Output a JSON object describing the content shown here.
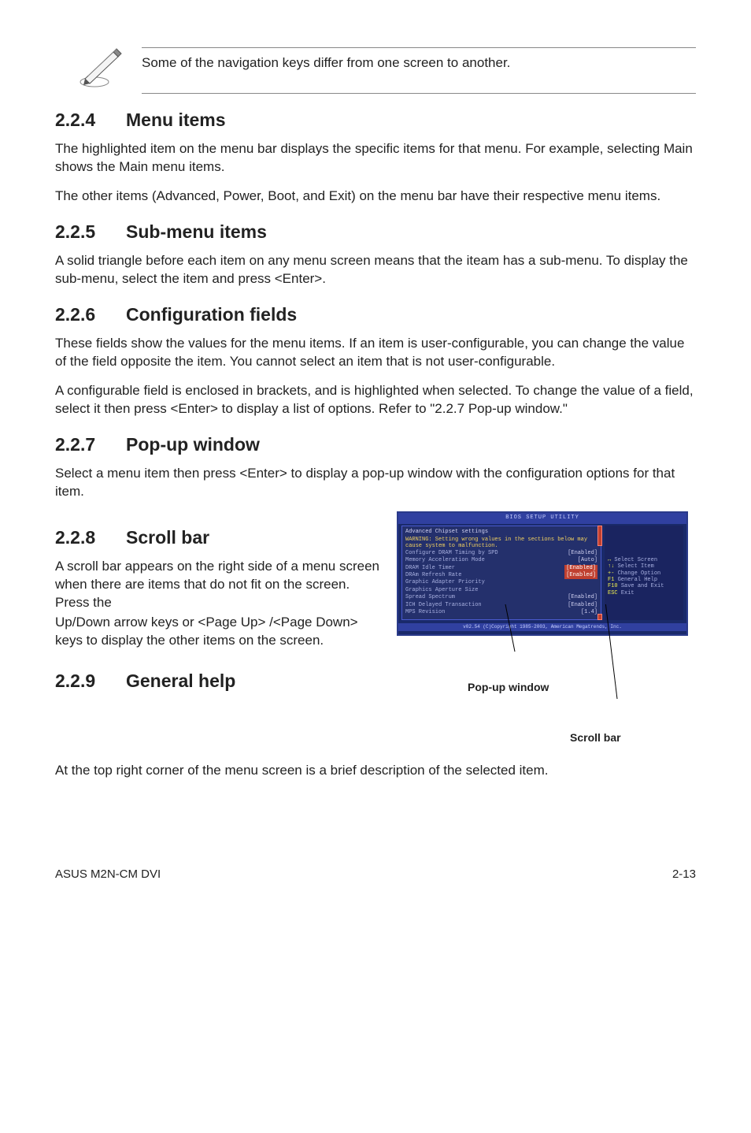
{
  "note": {
    "text": "Some of the navigation keys differ from one screen to another."
  },
  "s224": {
    "num": "2.2.4",
    "title": "Menu items",
    "p1": "The highlighted item on the menu bar  displays the specific items for that menu. For example, selecting Main shows the Main menu items.",
    "p2": "The other items (Advanced, Power, Boot, and Exit) on the menu bar have their respective menu items."
  },
  "s225": {
    "num": "2.2.5",
    "title": "Sub-menu items",
    "p1": "A solid triangle before each item on any menu screen means that the iteam has a sub-menu. To display the sub-menu, select the item and press <Enter>."
  },
  "s226": {
    "num": "2.2.6",
    "title": "Configuration fields",
    "p1": "These fields show the values for the menu items. If an item is user-configurable, you can change the value of the field opposite the item. You cannot select an item that is not user-configurable.",
    "p2": "A configurable field is enclosed in brackets, and is highlighted when selected. To change the value of a field, select it then press <Enter> to display a list of options. Refer to \"2.2.7 Pop-up window.\""
  },
  "s227": {
    "num": "2.2.7",
    "title": "Pop-up window",
    "p1": "Select a menu item then press <Enter> to display a pop-up window with the configuration options for that item."
  },
  "s228": {
    "num": "2.2.8",
    "title": "Scroll bar",
    "p1": "A scroll bar appears on the right side of a menu screen when there are items that do not fit on the screen. Press the",
    "p2": "Up/Down arrow keys or <Page Up> /<Page Down> keys to display the other items on the screen."
  },
  "s229": {
    "num": "2.2.9",
    "title": "General help",
    "p1": "At the top right corner of the menu screen is a brief description of the selected item."
  },
  "bios": {
    "titlebar": "BIOS SETUP UTILITY",
    "panel_header": "Advanced Chipset settings",
    "warning": "WARNING: Setting wrong values in the sections below may cause system to malfunction.",
    "rows": [
      {
        "label": "Configure DRAM Timing by SPD",
        "value": "[Enabled]",
        "sel": false
      },
      {
        "label": "Memory Acceleration Mode",
        "value": "[Auto]",
        "sel": false
      },
      {
        "label": "DRAM Idle Timer",
        "value": "[Enabled]",
        "sel": true
      },
      {
        "label": "DRAm Refresh Rate",
        "value": "[Enabled]",
        "sel": true
      },
      {
        "label": "",
        "value": "",
        "sel": false
      },
      {
        "label": "Graphic Adapter Priority",
        "value": "",
        "sel": false
      },
      {
        "label": "Graphics Aperture Size",
        "value": "",
        "sel": false
      },
      {
        "label": "Spread Spectrum",
        "value": "[Enabled]",
        "sel": false
      },
      {
        "label": "",
        "value": "",
        "sel": false
      },
      {
        "label": "ICH Delayed Transaction",
        "value": "[Enabled]",
        "sel": false
      },
      {
        "label": "",
        "value": "",
        "sel": false
      },
      {
        "label": "MPS Revision",
        "value": "[1.4]",
        "sel": false
      }
    ],
    "help": [
      {
        "key": "↔",
        "txt": "Select Screen"
      },
      {
        "key": "↑↓",
        "txt": "Select Item"
      },
      {
        "key": "+-",
        "txt": "Change Option"
      },
      {
        "key": "F1",
        "txt": "General Help"
      },
      {
        "key": "F10",
        "txt": "Save and Exit"
      },
      {
        "key": "ESC",
        "txt": "Exit"
      }
    ],
    "footer": "v02.54 (C)Copyright 1985-2003, American Megatrends, Inc."
  },
  "callouts": {
    "popup_label": "Pop-up window",
    "scroll_label": "Scroll bar"
  },
  "footer": {
    "left": "ASUS M2N-CM DVI",
    "right": "2-13"
  }
}
